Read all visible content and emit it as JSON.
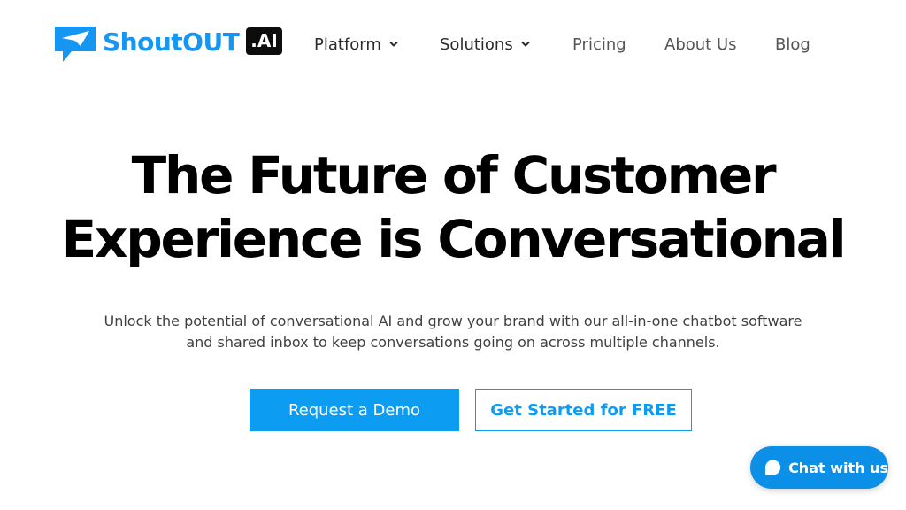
{
  "brand": {
    "name": "ShoutOUT",
    "badge": ".AI",
    "primary_color": "#1596f2",
    "badge_color": "#0d0d0d",
    "logo_icon": "paper-plane-chat-bubble-icon"
  },
  "nav": {
    "platform": "Platform",
    "solutions": "Solutions",
    "pricing": "Pricing",
    "about": "About Us",
    "blog": "Blog",
    "dropdown_icon": "chevron-down-icon"
  },
  "hero": {
    "title_line1": "The Future of Customer",
    "title_line2": "Experience is Conversational",
    "subtitle": "Unlock the potential of conversational AI and grow your brand with our all-in-one chatbot software and shared inbox to keep conversations going on across multiple channels."
  },
  "cta": {
    "primary": "Request a Demo",
    "secondary": "Get Started for FREE",
    "accent_color": "#0c9cf2"
  },
  "chat_widget": {
    "label": "Chat with us",
    "icon": "chat-bubble-icon",
    "color": "#0c8fe6"
  }
}
